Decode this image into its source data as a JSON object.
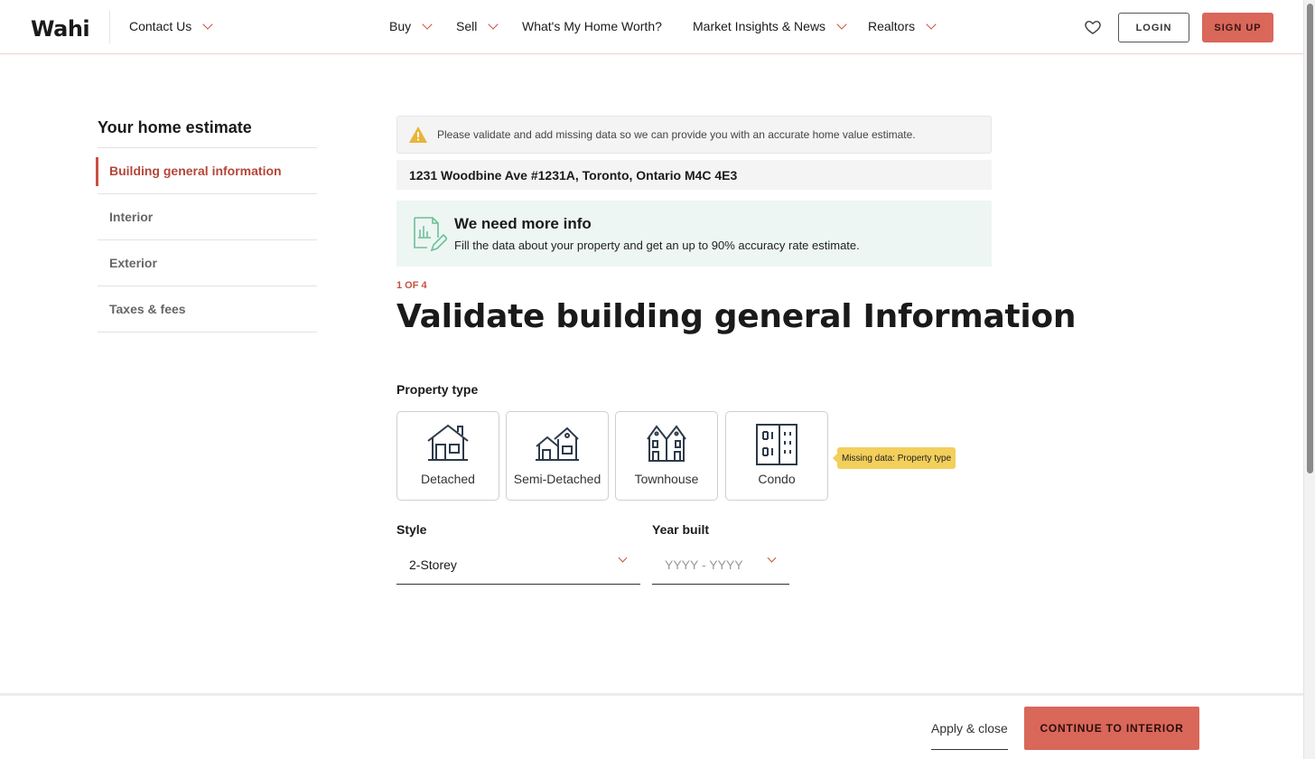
{
  "header": {
    "logo": "Wahi",
    "contact": "Contact Us",
    "nav": [
      "Buy",
      "Sell",
      "What's My Home Worth?",
      "Market Insights & News",
      "Realtors"
    ],
    "login": "LOGIN",
    "signup": "SIGN UP"
  },
  "sidebar": {
    "title": "Your home estimate",
    "items": [
      {
        "label": "Building general information",
        "active": true
      },
      {
        "label": "Interior",
        "active": false
      },
      {
        "label": "Exterior",
        "active": false
      },
      {
        "label": "Taxes & fees",
        "active": false
      }
    ]
  },
  "main": {
    "warning": "Please validate and add missing data so we can provide you with an accurate home value estimate.",
    "address": "1231 Woodbine Ave #1231A, Toronto, Ontario M4C 4E3",
    "info_title": "We need more info",
    "info_text": "Fill the data about your property and get an up to 90% accuracy rate estimate.",
    "step": "1 OF 4",
    "title": "Validate building general Information",
    "property_type_label": "Property type",
    "property_types": [
      "Detached",
      "Semi-Detached",
      "Townhouse",
      "Condo"
    ],
    "missing_tooltip": "Missing data: Property type",
    "style_label": "Style",
    "style_value": "2-Storey",
    "year_label": "Year built",
    "year_placeholder": "YYYY - YYYY"
  },
  "footer": {
    "apply": "Apply & close",
    "continue": "CONTINUE TO INTERIOR"
  },
  "colors": {
    "accent": "#d9675a",
    "accent_dark": "#c8503e",
    "info_bg": "#edf6f2",
    "tooltip": "#f3cf5b"
  }
}
